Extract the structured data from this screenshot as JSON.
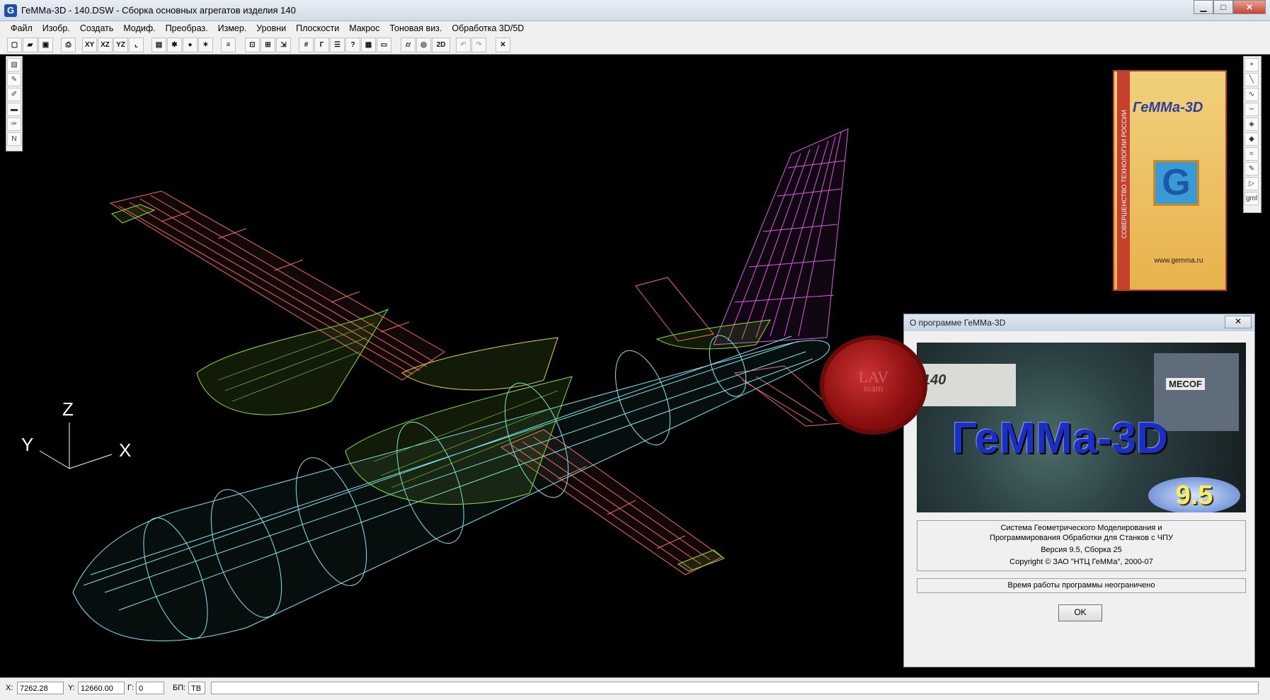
{
  "window": {
    "title": "ГеММа-3D - 140.DSW -  Сборка основных агрегатов изделия 140",
    "icon": "G",
    "minimize": "▁",
    "maximize": "□",
    "close": "✕"
  },
  "menu": [
    "Файл",
    "Изобр.",
    "Создать",
    "Модиф.",
    "Преобраз.",
    "Измер.",
    "Уровни",
    "Плоскости",
    "Макрос",
    "Тоновая виз.",
    "Обработка 3D/5D"
  ],
  "toolbar": {
    "xy": "XY",
    "xz": "XZ",
    "yz": "YZ",
    "mode2d": "2D",
    "close_view": "✕"
  },
  "right_toolbar_top": "+",
  "right_toolbar_bottom": "gml",
  "axes": {
    "z": "Z",
    "y": "Y",
    "x": "X"
  },
  "banner": {
    "logo": "ГеММа-3D",
    "vertical_text": "СОВЕРШЕНСТВО ТЕХНОЛОГИИ РОССИИ",
    "letter": "G",
    "url": "www.gemma.ru"
  },
  "seal": {
    "line1": "LAV",
    "line2": "team"
  },
  "about": {
    "title": "О программе ГеММа-3D",
    "close": "✕",
    "splash_brand": "ГеММа-3D",
    "splash_version": "9.5",
    "splash_mecof": "MECOF",
    "splash_140": "140",
    "line1": "Система Геометрического Моделирования и",
    "line2": "Программирования Обработки для Станков с ЧПУ",
    "version": "Версия 9.5, Сборка 25",
    "copyright": "Copyright © ЗАО \"НТЦ ГеММа\", 2000-07",
    "note": "Время работы программы неограничено",
    "ok": "OK"
  },
  "status": {
    "x_label": "X:",
    "x_value": "7262.28",
    "y_label": "Y:",
    "y_value": "12660.00",
    "g_label": "Г:",
    "g_value": "0",
    "bp_label": "БП:",
    "bp_value": "ТВ"
  },
  "colors": {
    "fuselage": "#7fe6f0",
    "wing": "#f06a6a",
    "engine": "#8be03a",
    "tail": "#d95be0",
    "yellow": "#e6d53a"
  }
}
